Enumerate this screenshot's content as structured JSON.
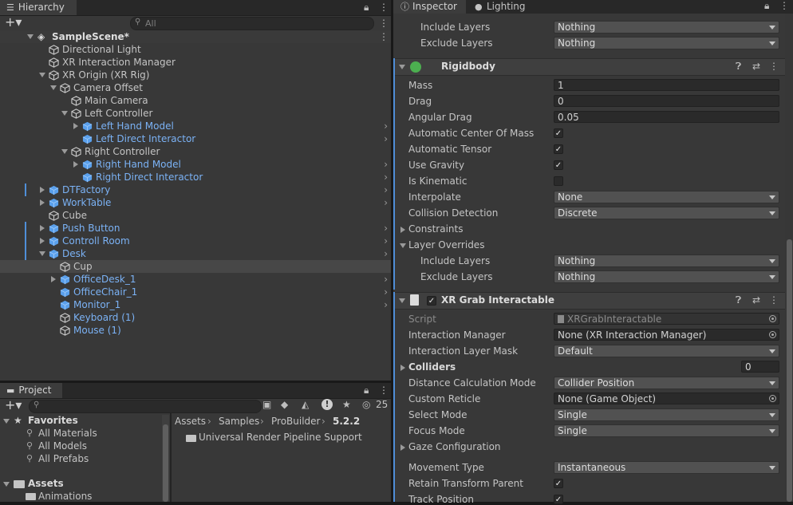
{
  "hierarchy": {
    "tab_title": "Hierarchy",
    "search_placeholder": "All",
    "scene_name": "SampleScene*",
    "items": [
      {
        "label": "Directional Light"
      },
      {
        "label": "XR Interaction Manager"
      },
      {
        "label": "XR Origin (XR Rig)"
      },
      {
        "label": "Camera Offset"
      },
      {
        "label": "Main Camera"
      },
      {
        "label": "Left Controller"
      },
      {
        "label": "Left Hand Model"
      },
      {
        "label": "Left Direct Interactor"
      },
      {
        "label": "Right Controller"
      },
      {
        "label": "Right Hand Model"
      },
      {
        "label": "Right Direct Interactor"
      },
      {
        "label": "DTFactory"
      },
      {
        "label": "WorkTable"
      },
      {
        "label": "Cube"
      },
      {
        "label": "Push Button"
      },
      {
        "label": "Controll Room"
      },
      {
        "label": "Desk"
      },
      {
        "label": "Cup"
      },
      {
        "label": "OfficeDesk_1"
      },
      {
        "label": "OfficeChair_1"
      },
      {
        "label": "Monitor_1"
      },
      {
        "label": "Keyboard (1)"
      },
      {
        "label": "Mouse (1)"
      }
    ]
  },
  "project": {
    "tab_title": "Project",
    "hidden_count": "25",
    "favorites_label": "Favorites",
    "favorites": [
      "All Materials",
      "All Models",
      "All Prefabs"
    ],
    "assets_label": "Assets",
    "assets_children": [
      "Animations"
    ],
    "breadcrumb": [
      "Assets",
      "Samples",
      "ProBuilder",
      "5.2.2"
    ],
    "files": [
      "Universal Render Pipeline Support"
    ]
  },
  "inspector": {
    "tab_inspector": "Inspector",
    "tab_lighting": "Lighting",
    "top_include_label": "Include Layers",
    "top_include_value": "Nothing",
    "top_exclude_label": "Exclude Layers",
    "top_exclude_value": "Nothing",
    "rigidbody": {
      "title": "Rigidbody",
      "mass_label": "Mass",
      "mass": "1",
      "drag_label": "Drag",
      "drag": "0",
      "angular_drag_label": "Angular Drag",
      "angular_drag": "0.05",
      "auto_com_label": "Automatic Center Of Mass",
      "auto_tensor_label": "Automatic Tensor",
      "use_gravity_label": "Use Gravity",
      "is_kinematic_label": "Is Kinematic",
      "interpolate_label": "Interpolate",
      "interpolate": "None",
      "collision_label": "Collision Detection",
      "collision": "Discrete",
      "constraints_label": "Constraints",
      "layer_overrides_label": "Layer Overrides",
      "include_label": "Include Layers",
      "include": "Nothing",
      "exclude_label": "Exclude Layers",
      "exclude": "Nothing"
    },
    "xrgrab": {
      "title": "XR Grab Interactable",
      "script_label": "Script",
      "script": "XRGrabInteractable",
      "interaction_manager_label": "Interaction Manager",
      "interaction_manager": "None (XR Interaction Manager)",
      "layer_mask_label": "Interaction Layer Mask",
      "layer_mask": "Default",
      "colliders_label": "Colliders",
      "colliders_count": "0",
      "distance_calc_label": "Distance Calculation Mode",
      "distance_calc": "Collider Position",
      "custom_reticle_label": "Custom Reticle",
      "custom_reticle": "None (Game Object)",
      "select_mode_label": "Select Mode",
      "select_mode": "Single",
      "focus_mode_label": "Focus Mode",
      "focus_mode": "Single",
      "gaze_label": "Gaze Configuration",
      "movement_type_label": "Movement Type",
      "movement_type": "Instantaneous",
      "retain_parent_label": "Retain Transform Parent",
      "track_position_label": "Track Position"
    }
  },
  "colors": {
    "prefab_blue": "#7bb2f5",
    "accent_blue": "#4f8ed8",
    "panel_bg": "#383838"
  }
}
